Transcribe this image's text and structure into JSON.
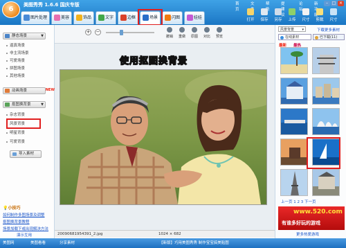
{
  "app": {
    "title": "美图秀秀 1.6.6 国庆专版",
    "logo_text": "6"
  },
  "top_menu": [
    "首页",
    "文件",
    "帮助",
    "提建议",
    "论坛",
    "新功能"
  ],
  "main_tabs": [
    {
      "label": "图片处理",
      "icon": "image-edit-icon",
      "color": "#4a8ad6"
    },
    {
      "label": "美容",
      "icon": "beauty-icon",
      "color": "#e86fb0"
    },
    {
      "label": "饰品",
      "icon": "accessory-icon",
      "color": "#f2b21c"
    },
    {
      "label": "文字",
      "icon": "text-icon",
      "color": "#42a84a"
    },
    {
      "label": "边框",
      "icon": "frame-icon",
      "color": "#d9422a"
    },
    {
      "label": "场景",
      "icon": "scene-icon",
      "color": "#2a6fc9"
    },
    {
      "label": "闪图",
      "icon": "flash-icon",
      "color": "#f07a10"
    },
    {
      "label": "娃娃",
      "icon": "doll-icon",
      "color": "#c55ad4"
    }
  ],
  "toolbar": [
    {
      "label": "打开",
      "icon": "open-icon"
    },
    {
      "label": "保存",
      "icon": "save-icon"
    },
    {
      "label": "另存",
      "icon": "save-as-icon"
    },
    {
      "label": "上传",
      "icon": "upload-icon"
    },
    {
      "label": "尺寸",
      "icon": "resize-icon"
    },
    {
      "label": "剪裁",
      "icon": "crop-icon"
    },
    {
      "label": "尺寸",
      "icon": "size-icon"
    }
  ],
  "sidebar": {
    "categories": [
      {
        "label": "静态场景",
        "icon": "static-scene-icon",
        "items": [
          "逼真场景",
          "非主流场景",
          "可爱场景",
          "拼图场景",
          "其他场景"
        ]
      },
      {
        "label": "动画场景",
        "icon": "animated-scene-icon",
        "badge": "NEW",
        "items": []
      },
      {
        "label": "抠图换背景",
        "icon": "cutout-icon",
        "items": [
          "杂志背景",
          "风景背景",
          "明星背景",
          "可爱背景"
        ]
      }
    ],
    "import_button": "导入素材",
    "tips_title": "小技巧",
    "tips": [
      "如何制作多图场景及调整",
      "抠图换背景教程",
      "场景加载下或出现解决方法"
    ],
    "footer": "演示互用"
  },
  "canvas": {
    "headline": "使用抠图换背景",
    "tools": [
      "撤销",
      "重做",
      "原图",
      "对比",
      "预览"
    ],
    "filename": "20090681954391_2.jpg",
    "dimensions": "1024  ×  682"
  },
  "right_panel": {
    "dropdown": "风景背景",
    "download_link": "下载更多素材",
    "tabs": [
      "在线素材",
      "已下载(11)"
    ],
    "sub_tabs": [
      "最新",
      "最热"
    ],
    "thumbnails": [
      "beach-palm",
      "pagoda",
      "blue-castle",
      "waterfront-buildings",
      "dock-sea",
      "sydney-opera",
      "castle-sunset",
      "sailboat",
      "eiffel-tower",
      "louvre-arch",
      "city-street",
      "taj-mahal"
    ],
    "pager": "上一页 1 2 3 下一页",
    "ad_line1": "www.520.com",
    "ad_line2": "有谁多好玩的游戏",
    "footer": "更多热爱游戏"
  },
  "bottom_bar": [
    "美图网",
    "美图看看",
    "分享素材",
    "【新版】巧用美图秀秀 制作宝宝搞美贴图"
  ]
}
